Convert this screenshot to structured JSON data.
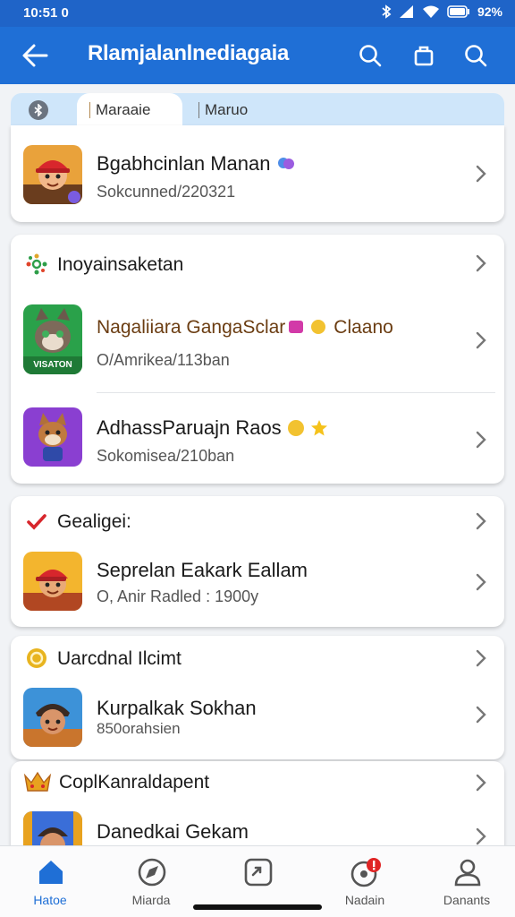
{
  "status": {
    "time": "10:51 0",
    "battery": "92%"
  },
  "appbar": {
    "title": "Rlamjalanlnediagaia"
  },
  "filters": {
    "chip1": "Maraaie",
    "chip2": "Maruo"
  },
  "cards": {
    "c1": {
      "name": "Bgabhcinlan Manan",
      "sub": "Sokcunned/220321"
    },
    "c2": {
      "title": "Inoyainsaketan",
      "r1": {
        "name": "Nagaliiara GangaSclar",
        "name2": "Claano",
        "sub": "O/Amrikea/113ban",
        "badge": "VISATON"
      },
      "r2": {
        "name": "AdhassParuajn Raos",
        "sub": "Sokomisea/210ban"
      }
    },
    "c3": {
      "title": "Gealigei:",
      "r1": {
        "name": "Seprelan Eakark Eallam",
        "sub": "O, Anir Radled : 1900y"
      }
    },
    "c4": {
      "title": "Uarcdnal Ilcimt",
      "r1": {
        "name": "Kurpalkak Sokhan",
        "sub": "850orahsien"
      }
    },
    "c5": {
      "title": "CoplKanraldapent",
      "r1": {
        "name": "Danedkai Gekam"
      }
    }
  },
  "nav": [
    "Hatoe",
    "Miarda",
    "",
    "Nadain",
    "Danants"
  ],
  "colors": {
    "primary": "#1f6fd6",
    "statusbar": "#1f64c8",
    "filter": "#cfe6fa",
    "badge": "#e02424"
  }
}
